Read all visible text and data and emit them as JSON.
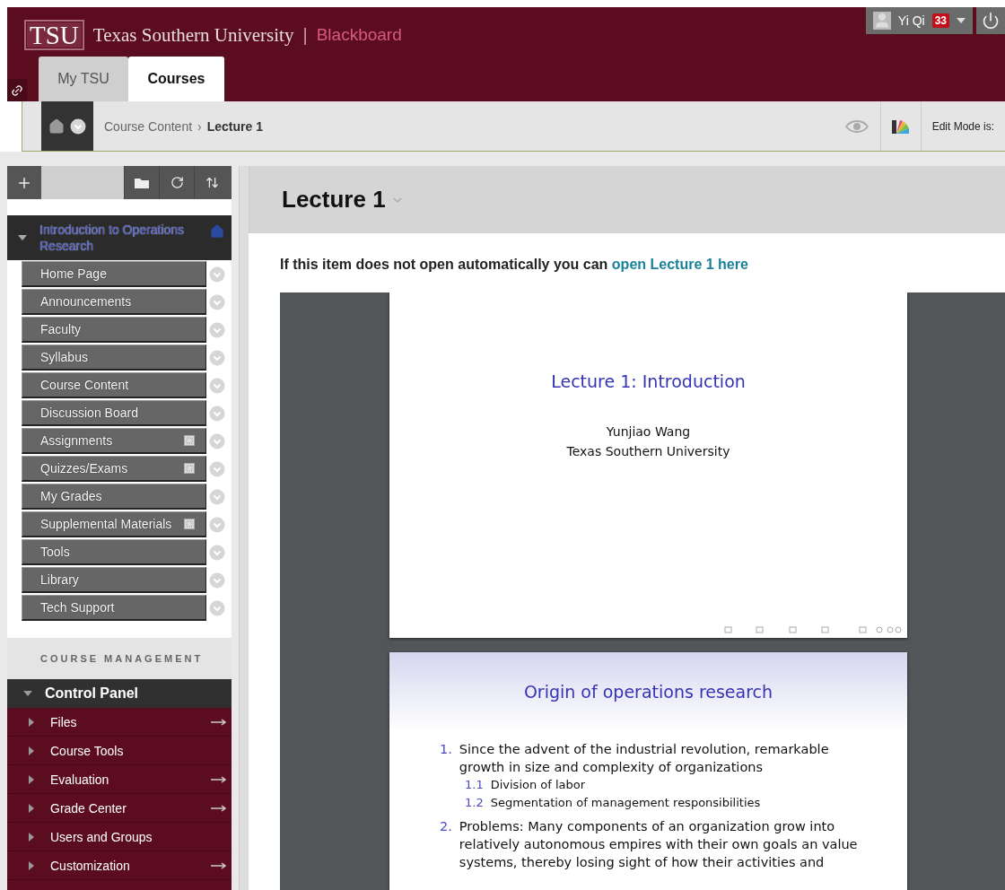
{
  "header": {
    "logo": "TSU",
    "site_title": "Texas Southern University",
    "separator": "|",
    "product": "Blackboard",
    "user": {
      "name": "Yi Qi",
      "badge": "33"
    },
    "tabs": [
      {
        "label": "My TSU",
        "selected": false
      },
      {
        "label": "Courses",
        "selected": true
      }
    ]
  },
  "breadcrumb": {
    "items": [
      {
        "label": "Course Content",
        "selected": false
      },
      {
        "label": "Lecture 1",
        "selected": true
      }
    ],
    "separator": "›",
    "edit_mode_label": "Edit Mode is:"
  },
  "sidebar": {
    "course_title": "Introduction to Operations Research",
    "menu": [
      {
        "label": "Home Page",
        "marked": false
      },
      {
        "label": "Announcements",
        "marked": false
      },
      {
        "label": "Faculty",
        "marked": false
      },
      {
        "label": "Syllabus",
        "marked": false
      },
      {
        "label": "Course Content",
        "marked": false
      },
      {
        "label": "Discussion Board",
        "marked": false
      },
      {
        "label": "Assignments",
        "marked": true
      },
      {
        "label": "Quizzes/Exams",
        "marked": true
      },
      {
        "label": "My Grades",
        "marked": false
      },
      {
        "label": "Supplemental Materials",
        "marked": true
      },
      {
        "label": "Tools",
        "marked": false
      },
      {
        "label": "Library",
        "marked": false
      },
      {
        "label": "Tech Support",
        "marked": false
      }
    ],
    "management_heading": "COURSE MANAGEMENT",
    "panel_title": "Control Panel",
    "panel_items": [
      {
        "label": "Files",
        "has_arrow": true
      },
      {
        "label": "Course Tools",
        "has_arrow": false
      },
      {
        "label": "Evaluation",
        "has_arrow": true
      },
      {
        "label": "Grade Center",
        "has_arrow": true
      },
      {
        "label": "Users and Groups",
        "has_arrow": false
      },
      {
        "label": "Customization",
        "has_arrow": true
      }
    ]
  },
  "content": {
    "title": "Lecture 1",
    "notice": "If this item does not open automatically you can",
    "notice_link": "open Lecture 1 here",
    "slides": [
      {
        "kind": "title",
        "title": "Lecture 1: Introduction",
        "lines": [
          "Yunjiao Wang",
          "Texas Southern University"
        ]
      },
      {
        "kind": "list",
        "title": "Origin of operations research",
        "items": [
          {
            "number": "1.",
            "text": "Since the advent of the industrial revolution, remarkable growth in size and complexity of organizations",
            "children": [
              {
                "number": "1.1",
                "text": "Division of labor"
              },
              {
                "number": "1.2",
                "text": "Segmentation of management responsibilities"
              }
            ]
          },
          {
            "number": "2.",
            "text": "Problems: Many components of an organization grow into relatively autonomous empires with their own goals an value systems, thereby losing sight of how their activities and"
          }
        ]
      }
    ]
  }
}
